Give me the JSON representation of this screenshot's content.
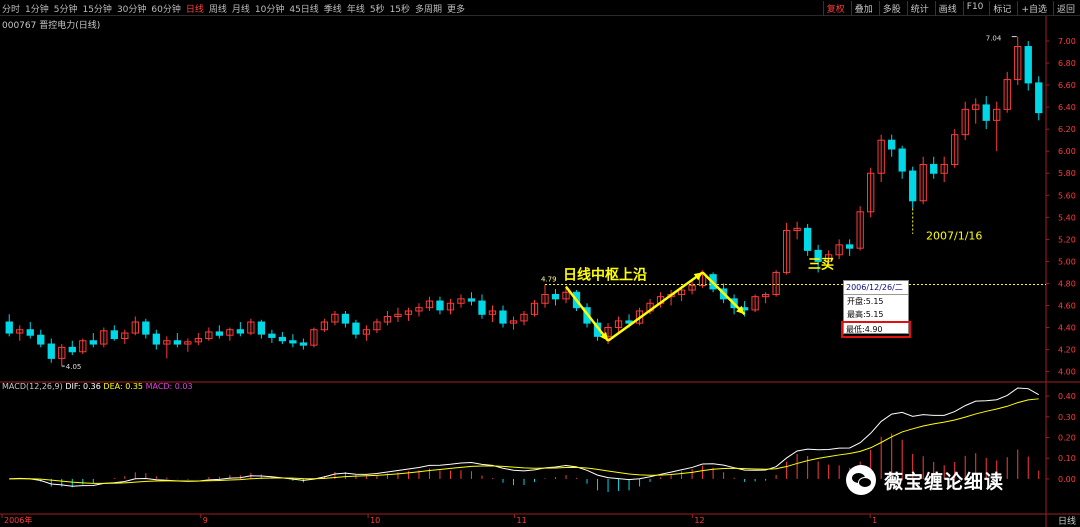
{
  "toolbar": {
    "periods": [
      "分时",
      "1分钟",
      "5分钟",
      "15分钟",
      "30分钟",
      "60分钟",
      "日线",
      "周线",
      "月线",
      "10分钟",
      "45日线",
      "季线",
      "年线",
      "5秒",
      "15秒",
      "多周期",
      "更多"
    ],
    "active_period": "日线",
    "right_menu": [
      "复权",
      "叠加",
      "多股",
      "统计",
      "画线",
      "F10",
      "标记",
      "+自选",
      "返回"
    ],
    "active_right": "复权"
  },
  "stock": {
    "title": "000767 晋控电力(日线)"
  },
  "macd": {
    "label": "MACD(12,26,9)",
    "dif": "DIF: 0.36",
    "dea": "DEA: 0.35",
    "macd": "MACD: 0.03"
  },
  "annotations": {
    "zhongshu": "日线中枢上沿",
    "sanmai": "三买",
    "date_note": "2007/1/16",
    "high_label": "7.04",
    "low_label": "4.05",
    "level_label": "4.79"
  },
  "tooltip": {
    "date": "2006/12/26/二",
    "open": "开盘:5.15",
    "high": "最高:5.15",
    "low": "最低:4.90"
  },
  "watermark": {
    "text": "薇宝缠论细读"
  },
  "bottom": {
    "label": "日线"
  },
  "colors": {
    "up": "#ff3b3b",
    "down": "#00d8e8",
    "dif": "#ffffff",
    "dea": "#ffff00",
    "annot": "#ffff00"
  },
  "chart_data": {
    "type": "candlestick",
    "price_axis": {
      "ticks": [
        "7.00",
        "6.80",
        "6.60",
        "6.40",
        "6.20",
        "6.00",
        "5.80",
        "5.60",
        "5.40",
        "5.20",
        "5.00",
        "4.80",
        "4.60",
        "4.40",
        "4.20",
        "4.00"
      ],
      "ylim": [
        3.96,
        7.1
      ]
    },
    "macd_axis": {
      "ticks": [
        "0.40",
        "0.30",
        "0.20",
        "0.10",
        "0.00"
      ],
      "ylim": [
        -0.16,
        0.42
      ]
    },
    "x_labels": [
      "2006年",
      "9",
      "10",
      "11",
      "12",
      "1"
    ],
    "candles": [
      [
        4.45,
        4.52,
        4.32,
        4.35
      ],
      [
        4.35,
        4.42,
        4.28,
        4.38
      ],
      [
        4.38,
        4.45,
        4.3,
        4.33
      ],
      [
        4.33,
        4.38,
        4.22,
        4.25
      ],
      [
        4.25,
        4.3,
        4.08,
        4.12
      ],
      [
        4.12,
        4.25,
        4.05,
        4.22
      ],
      [
        4.22,
        4.28,
        4.15,
        4.18
      ],
      [
        4.18,
        4.3,
        4.16,
        4.28
      ],
      [
        4.28,
        4.35,
        4.22,
        4.25
      ],
      [
        4.25,
        4.4,
        4.22,
        4.37
      ],
      [
        4.37,
        4.42,
        4.28,
        4.3
      ],
      [
        4.3,
        4.38,
        4.25,
        4.35
      ],
      [
        4.35,
        4.5,
        4.33,
        4.45
      ],
      [
        4.45,
        4.48,
        4.3,
        4.34
      ],
      [
        4.34,
        4.38,
        4.2,
        4.25
      ],
      [
        4.25,
        4.32,
        4.12,
        4.28
      ],
      [
        4.28,
        4.35,
        4.22,
        4.25
      ],
      [
        4.25,
        4.3,
        4.18,
        4.27
      ],
      [
        4.27,
        4.35,
        4.24,
        4.3
      ],
      [
        4.3,
        4.4,
        4.28,
        4.36
      ],
      [
        4.36,
        4.42,
        4.3,
        4.33
      ],
      [
        4.33,
        4.4,
        4.28,
        4.38
      ],
      [
        4.38,
        4.45,
        4.32,
        4.35
      ],
      [
        4.35,
        4.48,
        4.33,
        4.45
      ],
      [
        4.45,
        4.47,
        4.3,
        4.34
      ],
      [
        4.34,
        4.38,
        4.26,
        4.31
      ],
      [
        4.31,
        4.36,
        4.25,
        4.28
      ],
      [
        4.28,
        4.34,
        4.22,
        4.26
      ],
      [
        4.26,
        4.3,
        4.2,
        4.24
      ],
      [
        4.24,
        4.4,
        4.22,
        4.38
      ],
      [
        4.38,
        4.48,
        4.36,
        4.45
      ],
      [
        4.45,
        4.55,
        4.42,
        4.52
      ],
      [
        4.52,
        4.55,
        4.4,
        4.44
      ],
      [
        4.44,
        4.47,
        4.3,
        4.34
      ],
      [
        4.34,
        4.42,
        4.28,
        4.38
      ],
      [
        4.38,
        4.48,
        4.35,
        4.45
      ],
      [
        4.45,
        4.55,
        4.42,
        4.5
      ],
      [
        4.5,
        4.58,
        4.45,
        4.52
      ],
      [
        4.52,
        4.58,
        4.46,
        4.55
      ],
      [
        4.55,
        4.62,
        4.5,
        4.58
      ],
      [
        4.58,
        4.68,
        4.55,
        4.64
      ],
      [
        4.64,
        4.68,
        4.52,
        4.56
      ],
      [
        4.56,
        4.66,
        4.52,
        4.62
      ],
      [
        4.62,
        4.7,
        4.58,
        4.66
      ],
      [
        4.66,
        4.72,
        4.6,
        4.64
      ],
      [
        4.64,
        4.7,
        4.48,
        4.52
      ],
      [
        4.52,
        4.6,
        4.45,
        4.55
      ],
      [
        4.55,
        4.6,
        4.4,
        4.44
      ],
      [
        4.44,
        4.5,
        4.38,
        4.46
      ],
      [
        4.46,
        4.55,
        4.42,
        4.52
      ],
      [
        4.52,
        4.65,
        4.5,
        4.62
      ],
      [
        4.62,
        4.79,
        4.58,
        4.7
      ],
      [
        4.7,
        4.75,
        4.6,
        4.66
      ],
      [
        4.66,
        4.78,
        4.62,
        4.72
      ],
      [
        4.72,
        4.74,
        4.55,
        4.58
      ],
      [
        4.58,
        4.62,
        4.4,
        4.44
      ],
      [
        4.44,
        4.48,
        4.28,
        4.32
      ],
      [
        4.32,
        4.44,
        4.25,
        4.4
      ],
      [
        4.4,
        4.5,
        4.36,
        4.46
      ],
      [
        4.46,
        4.52,
        4.4,
        4.44
      ],
      [
        4.44,
        4.58,
        4.42,
        4.55
      ],
      [
        4.55,
        4.66,
        4.52,
        4.62
      ],
      [
        4.62,
        4.72,
        4.58,
        4.68
      ],
      [
        4.68,
        4.74,
        4.6,
        4.7
      ],
      [
        4.7,
        4.78,
        4.64,
        4.74
      ],
      [
        4.74,
        4.82,
        4.7,
        4.78
      ],
      [
        4.78,
        4.92,
        4.76,
        4.88
      ],
      [
        4.88,
        4.9,
        4.72,
        4.75
      ],
      [
        4.75,
        4.8,
        4.62,
        4.66
      ],
      [
        4.66,
        4.7,
        4.52,
        4.58
      ],
      [
        4.58,
        4.64,
        4.5,
        4.56
      ],
      [
        4.56,
        4.7,
        4.54,
        4.68
      ],
      [
        4.68,
        4.72,
        4.62,
        4.7
      ],
      [
        4.7,
        4.92,
        4.68,
        4.9
      ],
      [
        4.9,
        5.35,
        4.88,
        5.28
      ],
      [
        5.28,
        5.36,
        5.2,
        5.3
      ],
      [
        5.3,
        5.34,
        5.05,
        5.1
      ],
      [
        5.1,
        5.15,
        4.9,
        5.0
      ],
      [
        5.0,
        5.1,
        4.96,
        5.06
      ],
      [
        5.06,
        5.2,
        5.02,
        5.15
      ],
      [
        5.15,
        5.2,
        5.05,
        5.12
      ],
      [
        5.12,
        5.5,
        5.1,
        5.45
      ],
      [
        5.45,
        5.85,
        5.4,
        5.8
      ],
      [
        5.8,
        6.15,
        5.72,
        6.1
      ],
      [
        6.1,
        6.15,
        5.95,
        6.02
      ],
      [
        6.02,
        6.05,
        5.75,
        5.82
      ],
      [
        5.82,
        5.86,
        5.48,
        5.55
      ],
      [
        5.55,
        5.95,
        5.52,
        5.88
      ],
      [
        5.88,
        5.95,
        5.75,
        5.8
      ],
      [
        5.8,
        5.95,
        5.72,
        5.88
      ],
      [
        5.88,
        6.2,
        5.85,
        6.15
      ],
      [
        6.15,
        6.45,
        6.1,
        6.38
      ],
      [
        6.38,
        6.48,
        6.25,
        6.42
      ],
      [
        6.42,
        6.5,
        6.2,
        6.28
      ],
      [
        6.28,
        6.45,
        6.0,
        6.38
      ],
      [
        6.38,
        6.72,
        6.35,
        6.65
      ],
      [
        6.65,
        7.04,
        6.6,
        6.95
      ],
      [
        6.95,
        7.0,
        6.55,
        6.62
      ],
      [
        6.62,
        6.68,
        6.28,
        6.35
      ]
    ]
  }
}
